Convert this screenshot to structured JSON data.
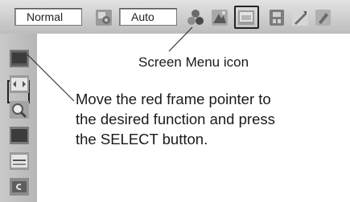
{
  "toolbar": {
    "picture_mode_value": "Normal",
    "setting_value": "Auto",
    "icons": [
      "picture-adjust-icon",
      "color-icon",
      "image-icon",
      "screen-menu-icon",
      "input-icon",
      "setting-icon",
      "extra-icon"
    ]
  },
  "sidebar": {
    "icons": [
      "normal-screen-icon",
      "true-screen-icon",
      "digital-zoom-icon",
      "full-screen-icon",
      "natural-wide-icon",
      "custom-icon"
    ]
  },
  "annotations": {
    "screen_menu_label": "Screen Menu icon",
    "instruction_lines": [
      "Move the red frame pointer to",
      "the desired function and press",
      "the SELECT button."
    ]
  },
  "colors": {
    "toolbar_bg": "#c8c8c8",
    "icon_gray": "#8a8a8a",
    "selection_frame": "#222222"
  }
}
